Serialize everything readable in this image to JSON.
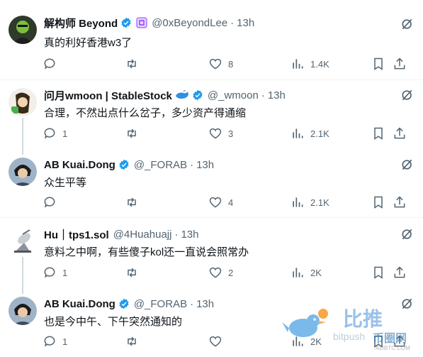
{
  "tweets": [
    {
      "name": "解构师 Beyond",
      "handle": "@0xBeyondLee",
      "time": "13h",
      "text": "真的利好香港w3了",
      "replies": "",
      "views": "1.4K",
      "likes": "8"
    },
    {
      "name": "问月wmoon | StableStock",
      "handle": "@_wmoon",
      "time": "13h",
      "text": "合理，不然出点什么岔子，多少资产得通缩",
      "replies": "1",
      "views": "2.1K",
      "likes": "3"
    },
    {
      "name": "AB Kuai.Dong",
      "handle": "@_FORAB",
      "time": "13h",
      "text": "众生平等",
      "replies": "",
      "views": "2.1K",
      "likes": "4"
    },
    {
      "name": "Hu｜tps1.sol",
      "handle": "@4Huahuajj",
      "time": "13h",
      "text": "意料之中啊，有些傻子kol还一直说会照常办",
      "replies": "1",
      "views": "2K",
      "likes": "2"
    },
    {
      "name": "AB Kuai.Dong",
      "handle": "@_FORAB",
      "time": "13h",
      "text": "也是今中午、下午突然通知的",
      "replies": "1",
      "views": "2K",
      "likes": ""
    }
  ],
  "watermark": {
    "line1": "比推",
    "line2": "bitpush",
    "site": "币圈网",
    "url": "ALIBTC.COM"
  },
  "colors": {
    "verified": "#1d9bf0",
    "text": "#0f1419",
    "muted": "#536471"
  }
}
